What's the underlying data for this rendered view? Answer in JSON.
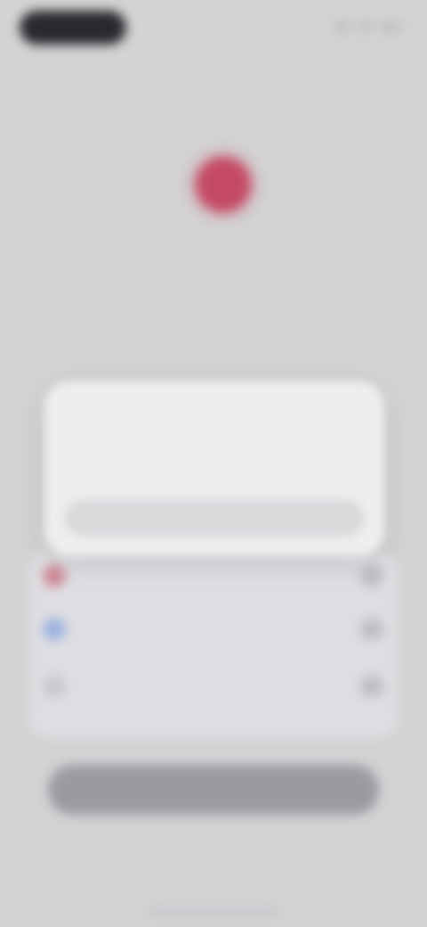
{
  "screen": {
    "title": "",
    "section_heading": "",
    "description": "",
    "primary_button_label": "",
    "secondary_link_label": ""
  },
  "list": {
    "items": [
      {
        "label": "",
        "accent": "#c44a64"
      },
      {
        "label": "",
        "accent": "#6b8fd6"
      },
      {
        "label": "",
        "accent": "#b8b8bc"
      }
    ]
  },
  "modal": {
    "title": "",
    "body": "",
    "button_label": ""
  },
  "colors": {
    "background": "#d3d3d5",
    "modal_background": "#eeeef0",
    "accent": "#c44a64"
  }
}
